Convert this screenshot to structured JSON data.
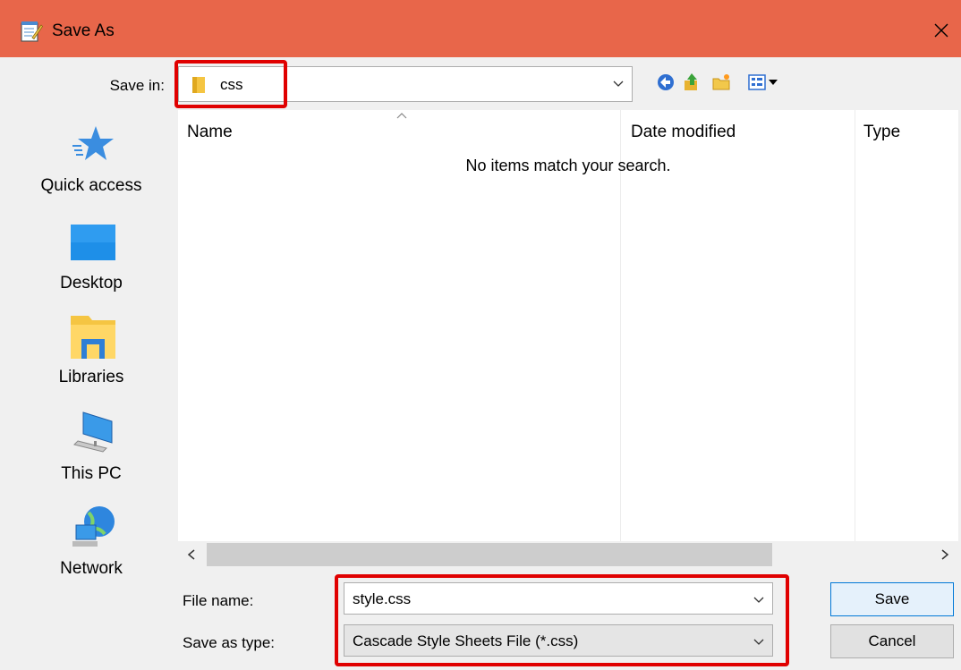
{
  "window": {
    "title": "Save As",
    "close_label": "✕",
    "titlebar_color": "#e8664a",
    "icon": "notepad-icon"
  },
  "save_in": {
    "label": "Save in:",
    "value": "css",
    "icon": "folder-icon"
  },
  "toolbar": {
    "icons": [
      "back-icon",
      "up-folder-icon",
      "new-folder-icon",
      "view-menu-icon"
    ]
  },
  "places": [
    {
      "label": "Quick access",
      "icon": "star-icon"
    },
    {
      "label": "Desktop",
      "icon": "desktop-icon"
    },
    {
      "label": "Libraries",
      "icon": "libraries-icon"
    },
    {
      "label": "This PC",
      "icon": "computer-icon"
    },
    {
      "label": "Network",
      "icon": "network-icon"
    }
  ],
  "filelist": {
    "columns": [
      "Name",
      "Date modified",
      "Type"
    ],
    "empty_message": "No items match your search."
  },
  "scrollbar": {
    "left_arrow": "<",
    "right_arrow": ">"
  },
  "file_name": {
    "label": "File name:",
    "value": "style.css"
  },
  "save_as_type": {
    "label": "Save as type:",
    "value": "Cascade Style Sheets File (*.css)"
  },
  "buttons": {
    "save": "Save",
    "cancel": "Cancel"
  },
  "colors": {
    "highlight_box": "#e00000",
    "primary_button_border": "#0078d7"
  }
}
